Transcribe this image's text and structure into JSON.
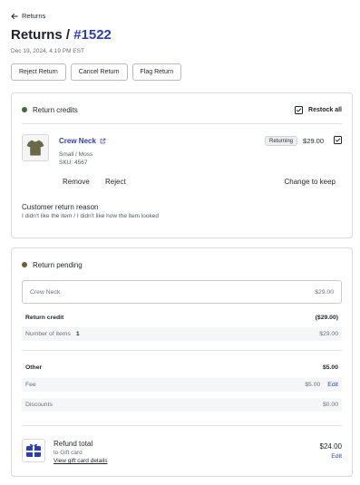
{
  "nav": {
    "back_label": "Returns"
  },
  "header": {
    "title_prefix": "Returns /",
    "order_id": "#1522",
    "date": "Dec 19, 2024, 4:19 PM EST"
  },
  "actions": {
    "reject_label": "Reject Return",
    "cancel_label": "Cancel Return",
    "flag_label": "Flag Return"
  },
  "return_credits": {
    "title": "Return credits",
    "restock_label": "Restock all",
    "restock_checked": true,
    "item": {
      "name": "Crew Neck",
      "variant": "Small / Moss",
      "sku": "SKU: 4567",
      "badge": "Returning",
      "price": "$29.00",
      "checked": true,
      "image_icon": "tshirt-icon",
      "color": "#6b6a48"
    },
    "remove_label": "Remove",
    "reject_label": "Reject",
    "change_label": "Change to keep",
    "reason_title": "Customer return reason",
    "reason_text": "I didn't like the item / I didn't like how the item looked"
  },
  "return_pending": {
    "title": "Return pending",
    "summary_item": "Crew Neck",
    "summary_amount": "$29.00",
    "credit_label": "Return credit",
    "credit_amount": "($29.00)",
    "items_label": "Number of items",
    "items_count": "1",
    "items_amount": "$29.00",
    "other_label": "Other",
    "other_amount": "$5.00",
    "fee_label": "Fee",
    "fee_amount": "$5.00",
    "fee_edit": "Edit",
    "discounts_label": "Discounts",
    "discounts_amount": "$0.00",
    "refund_title": "Refund total",
    "refund_to": "to Gift card",
    "refund_link": "View gift card details",
    "refund_amount": "$24.00",
    "refund_edit": "Edit"
  },
  "colors": {
    "accent": "#2c3fb8",
    "credits_dot": "#3f6b34",
    "pending_dot": "#7a5a2e",
    "gift_card": "#2c3fb8"
  }
}
